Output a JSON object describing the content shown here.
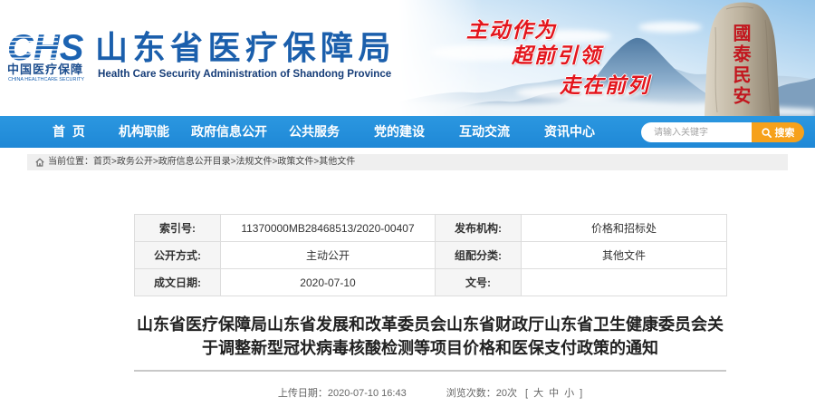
{
  "colors": {
    "brand_blue": "#1b5fac",
    "nav_blue": "#1f88d6",
    "search_orange": "#f6a11b",
    "slogan_red": "#e3151c",
    "label_bg": "#f5f5f5",
    "border_gray": "#dddddd"
  },
  "icons": {
    "breadcrumb_home": "home-icon",
    "search": "search-icon"
  },
  "header": {
    "logo": {
      "abbr": "CHS",
      "cn": "中国医疗保障",
      "en": "CHINA HEALTHCARE SECURITY"
    },
    "site_title": "山东省医疗保障局",
    "site_subtitle": "Health Care Security Administration of Shandong Province",
    "banner": {
      "slogans": [
        "主动作为",
        "超前引领",
        "走在前列"
      ],
      "inscription": "國泰民安"
    }
  },
  "nav": {
    "items": [
      {
        "label": "首 页"
      },
      {
        "label": "机构职能"
      },
      {
        "label": "政府信息公开"
      },
      {
        "label": "公共服务"
      },
      {
        "label": "党的建设"
      },
      {
        "label": "互动交流"
      },
      {
        "label": "资讯中心"
      }
    ],
    "search": {
      "placeholder": "请输入关键字",
      "button_label": "搜索"
    }
  },
  "breadcrumb": {
    "label": "当前位置：",
    "separator": ">",
    "items": [
      "首页",
      "政务公开",
      "政府信息公开目录",
      "法规文件",
      "政策文件",
      "其他文件"
    ]
  },
  "meta_table": {
    "rows": [
      [
        {
          "label": "索引号:",
          "value": "11370000MB28468513/2020-00407"
        },
        {
          "label": "发布机构:",
          "value": "价格和招标处"
        }
      ],
      [
        {
          "label": "公开方式:",
          "value": "主动公开"
        },
        {
          "label": "组配分类:",
          "value": "其他文件"
        }
      ],
      [
        {
          "label": "成文日期:",
          "value": "2020-07-10"
        },
        {
          "label": "文号:"
        }
      ]
    ]
  },
  "article": {
    "title": "山东省医疗保障局山东省发展和改革委员会山东省财政厅山东省卫生健康委员会关于调整新型冠状病毒核酸检测等项目价格和医保支付政策的通知",
    "upload_label": "上传日期：",
    "upload_date": "2020-07-10 16:43",
    "views_label": "浏览次数：",
    "views": "20次",
    "font_size_open": "[",
    "font_size_options": [
      "大",
      "中",
      "小"
    ],
    "font_size_close": "]"
  }
}
